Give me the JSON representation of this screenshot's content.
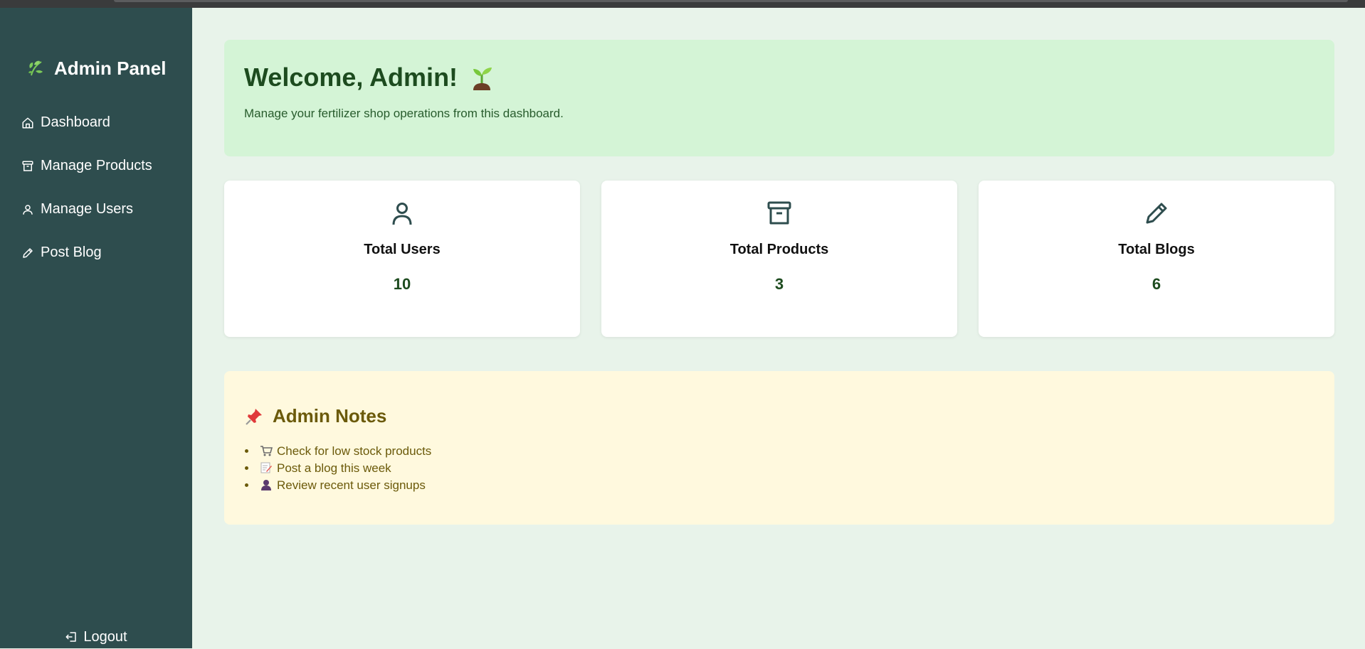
{
  "sidebar": {
    "brand_title": "Admin Panel",
    "items": [
      {
        "label": "Dashboard",
        "icon": "home-icon"
      },
      {
        "label": "Manage Products",
        "icon": "archive-icon"
      },
      {
        "label": "Manage Users",
        "icon": "user-icon"
      },
      {
        "label": "Post Blog",
        "icon": "pencil-icon"
      }
    ],
    "logout_label": "Logout"
  },
  "welcome": {
    "title": "Welcome, Admin!",
    "subtitle": "Manage your fertilizer shop operations from this dashboard."
  },
  "stats": [
    {
      "label": "Total Users",
      "value": "10",
      "icon": "user-icon"
    },
    {
      "label": "Total Products",
      "value": "3",
      "icon": "archive-icon"
    },
    {
      "label": "Total Blogs",
      "value": "6",
      "icon": "pencil-icon"
    }
  ],
  "notes": {
    "title": "Admin Notes",
    "items": [
      {
        "text": "Check for low stock products",
        "icon": "cart-icon"
      },
      {
        "text": "Post a blog this week",
        "icon": "memo-icon"
      },
      {
        "text": "Review recent user signups",
        "icon": "person-icon"
      }
    ]
  },
  "colors": {
    "sidebar_bg": "#2e4d4e",
    "page_bg": "#e8f3ea",
    "welcome_bg": "#d4f4d6",
    "notes_bg": "#fff9de",
    "accent_green": "#1d4b1f",
    "notes_text": "#6b5a0a"
  }
}
